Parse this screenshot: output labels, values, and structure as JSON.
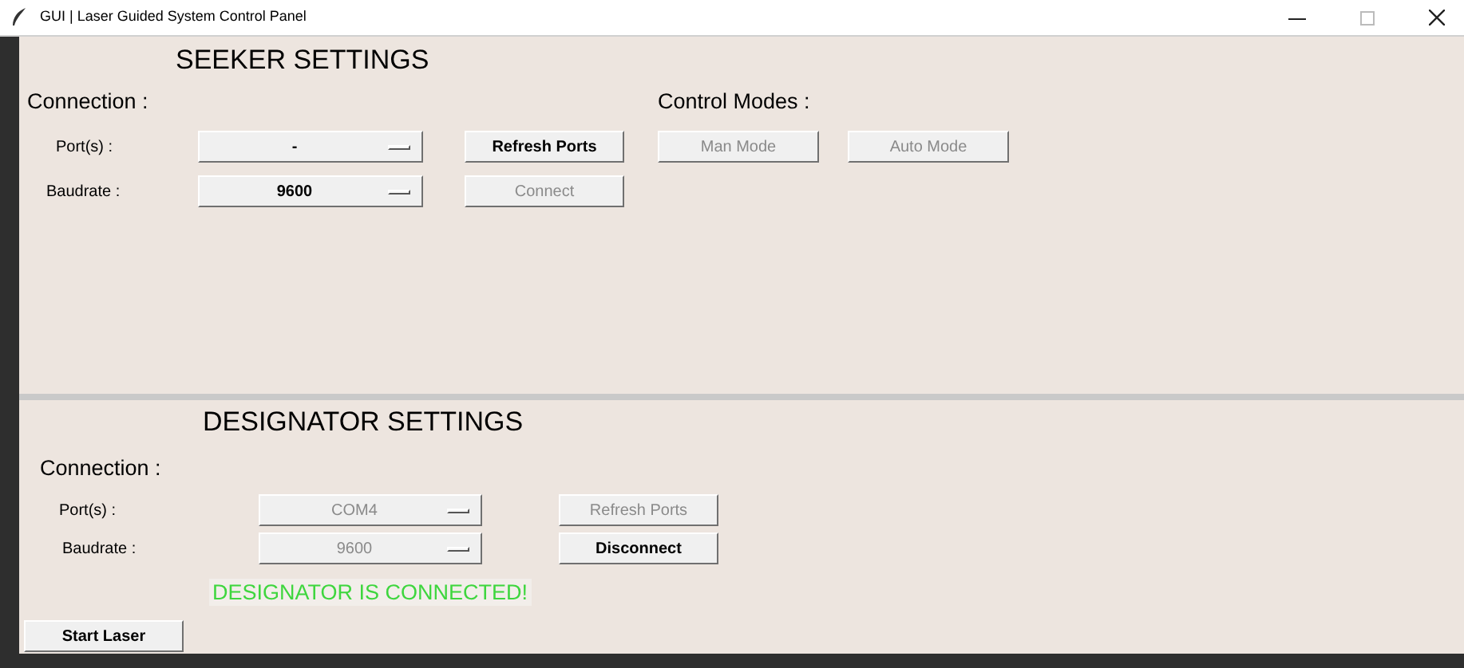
{
  "window": {
    "title": "GUI | Laser Guided System Control Panel"
  },
  "seeker": {
    "title": "SEEKER SETTINGS",
    "connection_label": "Connection :",
    "control_modes_label": "Control Modes :",
    "rows": [
      {
        "label": "Port(s) :",
        "value": "-",
        "disabled": false,
        "button": {
          "label": "Refresh Ports",
          "disabled": false
        }
      },
      {
        "label": "Baudrate :",
        "value": "9600",
        "disabled": false,
        "button": {
          "label": "Connect",
          "disabled": true
        }
      }
    ],
    "mode_buttons": [
      {
        "label": "Man Mode",
        "disabled": true
      },
      {
        "label": "Auto Mode",
        "disabled": true
      }
    ]
  },
  "designator": {
    "title": "DESIGNATOR SETTINGS",
    "connection_label": "Connection :",
    "rows": [
      {
        "label": "Port(s) :",
        "value": "COM4",
        "disabled": true,
        "button": {
          "label": "Refresh Ports",
          "disabled": true
        }
      },
      {
        "label": "Baudrate :",
        "value": "9600",
        "disabled": true,
        "button": {
          "label": "Disconnect",
          "disabled": false
        }
      }
    ],
    "status": "DESIGNATOR IS CONNECTED!",
    "start_button": {
      "label": "Start Laser",
      "disabled": false
    }
  }
}
